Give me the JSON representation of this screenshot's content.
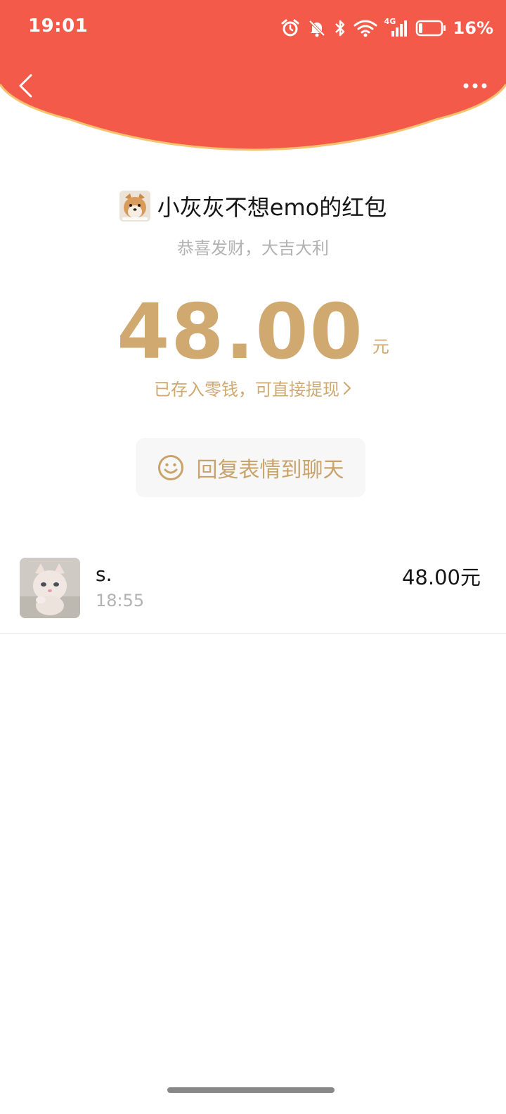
{
  "status_bar": {
    "time": "19:01",
    "network": "4G",
    "battery_percent": "16%",
    "icons": [
      "alarm-icon",
      "mute-bell-icon",
      "bluetooth-icon",
      "wifi-icon",
      "signal-icon",
      "battery-icon"
    ]
  },
  "nav": {
    "back_icon": "chevron-left-icon",
    "more_icon": "more-dots-icon"
  },
  "envelope": {
    "sender_title": "小灰灰不想emo的红包",
    "wish": "恭喜发财，大吉大利",
    "amount": "48.00",
    "unit": "元",
    "stored_text": "已存入零钱，可直接提现",
    "reply_label": "回复表情到聊天"
  },
  "records": [
    {
      "name": "s.",
      "time": "18:55",
      "amount": "48.00元"
    }
  ],
  "colors": {
    "header_red": "#F45A49",
    "header_edge": "#F5C270",
    "gold": "#CFA970",
    "gray_text": "#B2B2B2"
  }
}
